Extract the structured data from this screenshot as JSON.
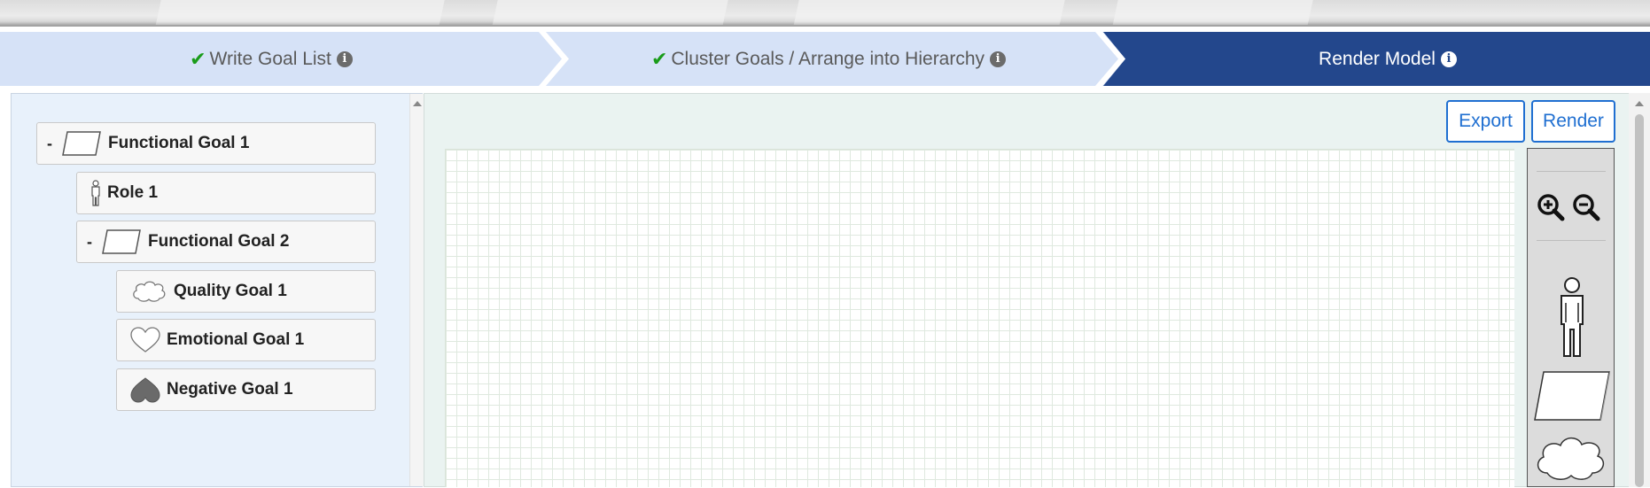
{
  "steps": [
    {
      "label": "Write Goal List",
      "done": true
    },
    {
      "label": "Cluster Goals / Arrange into Hierarchy",
      "done": true
    },
    {
      "label": "Render Model",
      "done": false,
      "active": true
    }
  ],
  "info_glyph": "i",
  "tree": {
    "toggle": "-",
    "nodes": [
      {
        "label": "Functional Goal 1",
        "icon": "functional-goal-icon"
      },
      {
        "label": "Role 1",
        "icon": "role-icon"
      },
      {
        "label": "Functional Goal 2",
        "icon": "functional-goal-icon"
      },
      {
        "label": "Quality Goal 1",
        "icon": "quality-goal-icon"
      },
      {
        "label": "Emotional Goal 1",
        "icon": "emotional-goal-icon"
      },
      {
        "label": "Negative Goal 1",
        "icon": "negative-goal-icon"
      }
    ]
  },
  "toolbar": {
    "export_label": "Export",
    "render_label": "Render"
  },
  "palette": {
    "items": [
      "zoom-in-icon",
      "zoom-out-icon",
      "role-icon",
      "functional-goal-icon",
      "quality-goal-icon"
    ]
  },
  "colors": {
    "active_step": "#23478c",
    "inactive_step": "#d6e2f7",
    "check": "#1a9c1a",
    "button": "#1f6fd1"
  }
}
